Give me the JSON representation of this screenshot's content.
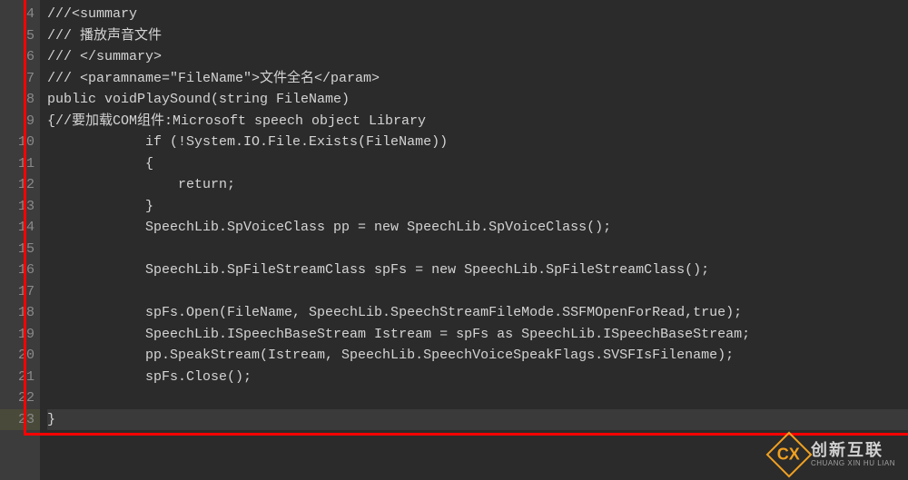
{
  "gutter": {
    "start": 4,
    "end": 23,
    "current": 23
  },
  "code": {
    "lines": [
      "///<summary",
      "/// 播放声音文件",
      "/// </summary>",
      "/// <paramname=\"FileName\">文件全名</param>",
      "public voidPlaySound(string FileName)",
      "{//要加载COM组件:Microsoft speech object Library",
      "            if (!System.IO.File.Exists(FileName))",
      "            {",
      "                return;",
      "            }",
      "            SpeechLib.SpVoiceClass pp = new SpeechLib.SpVoiceClass();",
      "",
      "            SpeechLib.SpFileStreamClass spFs = new SpeechLib.SpFileStreamClass();",
      "",
      "            spFs.Open(FileName, SpeechLib.SpeechStreamFileMode.SSFMOpenForRead,true);",
      "            SpeechLib.ISpeechBaseStream Istream = spFs as SpeechLib.ISpeechBaseStream;",
      "            pp.SpeakStream(Istream, SpeechLib.SpeechVoiceSpeakFlags.SVSFIsFilename);",
      "            spFs.Close();",
      "",
      "}"
    ]
  },
  "logo": {
    "badge": "CX",
    "main": "创新互联",
    "sub": "CHUANG XIN HU LIAN"
  }
}
